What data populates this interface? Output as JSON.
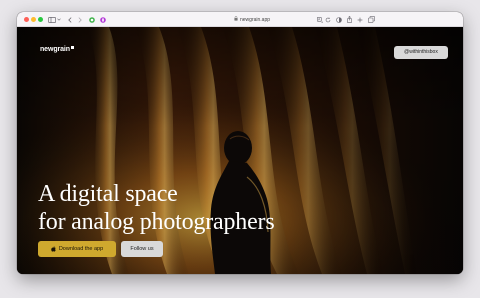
{
  "browser": {
    "url": "newgrain.app",
    "colors": {
      "close": "#fe5f57",
      "minimize": "#febc2e",
      "maximize": "#28c840"
    },
    "icons": [
      "sidebar-icon",
      "chevron-down-icon",
      "back-icon",
      "forward-icon",
      "shield-icon",
      "extension-icon",
      "lock-icon",
      "translate-icon",
      "reload-icon",
      "dark-mode-icon",
      "share-icon",
      "new-tab-icon",
      "tabs-icon"
    ]
  },
  "site": {
    "logo": "newgrain",
    "handle_button": "@withinthisbox",
    "headline_line1": "A digital space",
    "headline_line2": "for analog photographers",
    "download_button": "Download the app",
    "follow_button": "Follow us",
    "accent_color": "#cfa92e"
  }
}
